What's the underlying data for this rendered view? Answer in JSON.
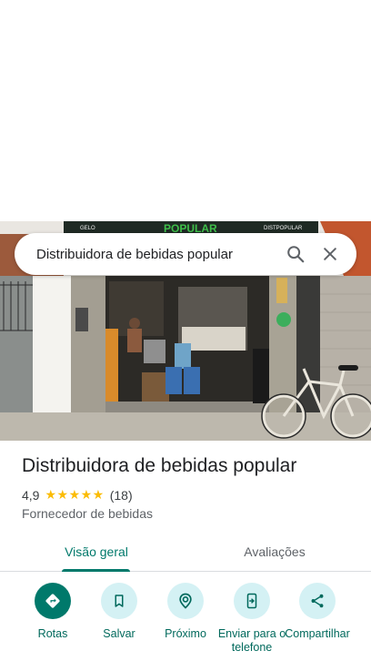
{
  "search": {
    "query": "Distribuidora de bebidas popular",
    "search_icon": "search-icon",
    "close_icon": "close-icon"
  },
  "photo": {
    "sign_text_left": "GELO",
    "sign_text_center": "POPULAR",
    "sign_text_right": "DISTPOPULAR"
  },
  "place": {
    "name": "Distribuidora de bebidas popular",
    "rating": "4,9",
    "stars": "★★★★★",
    "review_count": "(18)",
    "category": "Fornecedor de bebidas"
  },
  "tabs": [
    {
      "label": "Visão geral",
      "active": true
    },
    {
      "label": "Avaliações",
      "active": false
    }
  ],
  "actions": [
    {
      "label": "Rotas",
      "icon": "directions-icon"
    },
    {
      "label": "Salvar",
      "icon": "bookmark-icon"
    },
    {
      "label": "Próximo",
      "icon": "nearby-icon"
    },
    {
      "label": "Enviar para o telefone",
      "icon": "send-to-phone-icon"
    },
    {
      "label": "Compartilhar",
      "icon": "share-icon"
    }
  ],
  "colors": {
    "accent": "#00796b",
    "action_bg": "#d4f1f4",
    "star": "#fbbc04"
  }
}
